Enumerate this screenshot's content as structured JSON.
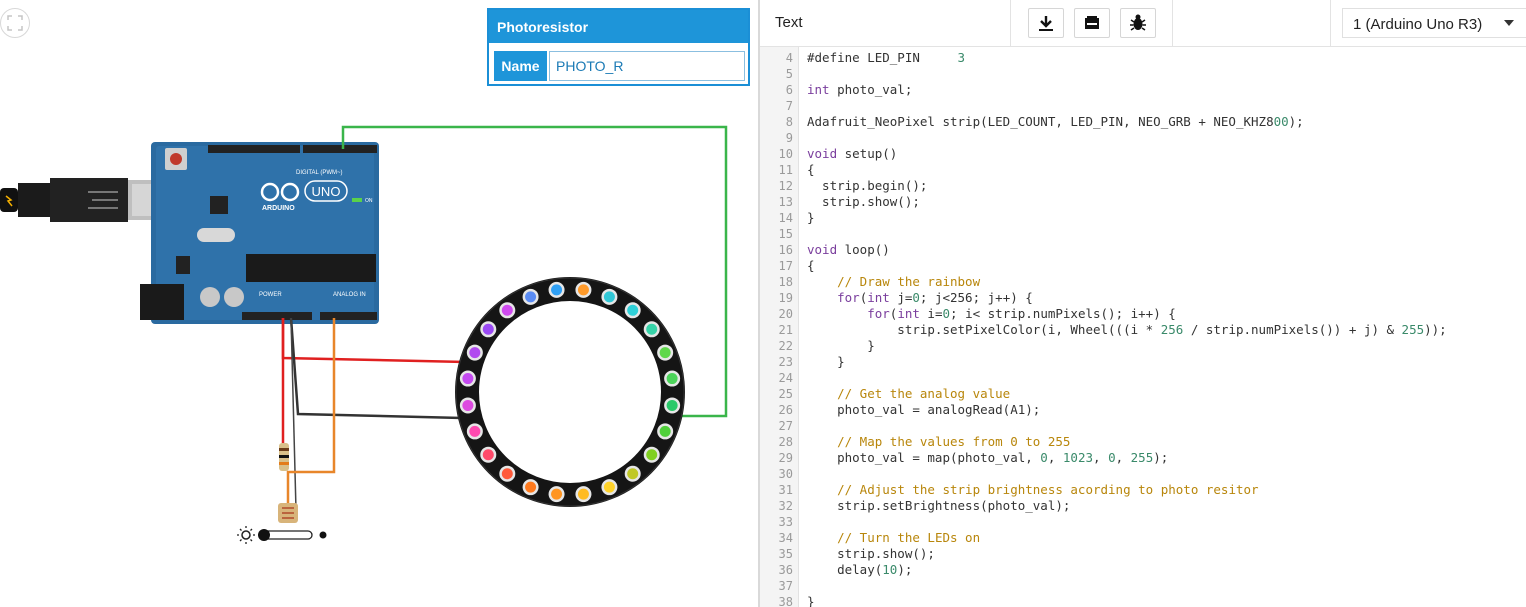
{
  "panel": {
    "title": "Photoresistor",
    "name_label": "Name",
    "name_value": "PHOTO_R"
  },
  "toolbar": {
    "mode": "Text",
    "download_icon": "download-icon",
    "library_icon": "library-icon",
    "debug_icon": "bug-icon",
    "device": "1 (Arduino Uno R3)"
  },
  "board": {
    "brand": "ARDUINO",
    "model": "UNO",
    "digital_label": "DIGITAL (PWM~)",
    "power_label": "POWER",
    "analog_label": "ANALOG IN",
    "on_label": "ON"
  },
  "colors": {
    "accent": "#1e95d9",
    "board": "#2a6aa0",
    "wire_green": "#3ab54a",
    "wire_red": "#e02020",
    "wire_black": "#333333",
    "wire_orange": "#e8862a"
  },
  "code_lines": [
    {
      "n": "4",
      "t": "#define LED_PIN     3"
    },
    {
      "n": "5",
      "t": ""
    },
    {
      "n": "6",
      "t": "int photo_val;"
    },
    {
      "n": "7",
      "t": ""
    },
    {
      "n": "8",
      "t": "Adafruit_NeoPixel strip(LED_COUNT, LED_PIN, NEO_GRB + NEO_KHZ800);"
    },
    {
      "n": "9",
      "t": ""
    },
    {
      "n": "10",
      "t": "void setup()"
    },
    {
      "n": "11",
      "t": "{"
    },
    {
      "n": "12",
      "t": "  strip.begin();"
    },
    {
      "n": "13",
      "t": "  strip.show();"
    },
    {
      "n": "14",
      "t": "}"
    },
    {
      "n": "15",
      "t": ""
    },
    {
      "n": "16",
      "t": "void loop()"
    },
    {
      "n": "17",
      "t": "{"
    },
    {
      "n": "18",
      "t": "    // Draw the rainbow"
    },
    {
      "n": "19",
      "t": "    for(int j=0; j<256; j++) {"
    },
    {
      "n": "20",
      "t": "        for(int i=0; i< strip.numPixels(); i++) {"
    },
    {
      "n": "21",
      "t": "            strip.setPixelColor(i, Wheel(((i * 256 / strip.numPixels()) + j) & 255));"
    },
    {
      "n": "22",
      "t": "        }"
    },
    {
      "n": "23",
      "t": "    }"
    },
    {
      "n": "24",
      "t": ""
    },
    {
      "n": "25",
      "t": "    // Get the analog value"
    },
    {
      "n": "26",
      "t": "    photo_val = analogRead(A1);"
    },
    {
      "n": "27",
      "t": ""
    },
    {
      "n": "28",
      "t": "    // Map the values from 0 to 255"
    },
    {
      "n": "29",
      "t": "    photo_val = map(photo_val, 0, 1023, 0, 255);"
    },
    {
      "n": "30",
      "t": ""
    },
    {
      "n": "31",
      "t": "    // Adjust the strip brightness acording to photo resitor"
    },
    {
      "n": "32",
      "t": "    strip.setBrightness(photo_val);"
    },
    {
      "n": "33",
      "t": ""
    },
    {
      "n": "34",
      "t": "    // Turn the LEDs on"
    },
    {
      "n": "35",
      "t": "    strip.show();"
    },
    {
      "n": "36",
      "t": "    delay(10);"
    },
    {
      "n": "37",
      "t": ""
    },
    {
      "n": "38",
      "t": "}"
    }
  ]
}
